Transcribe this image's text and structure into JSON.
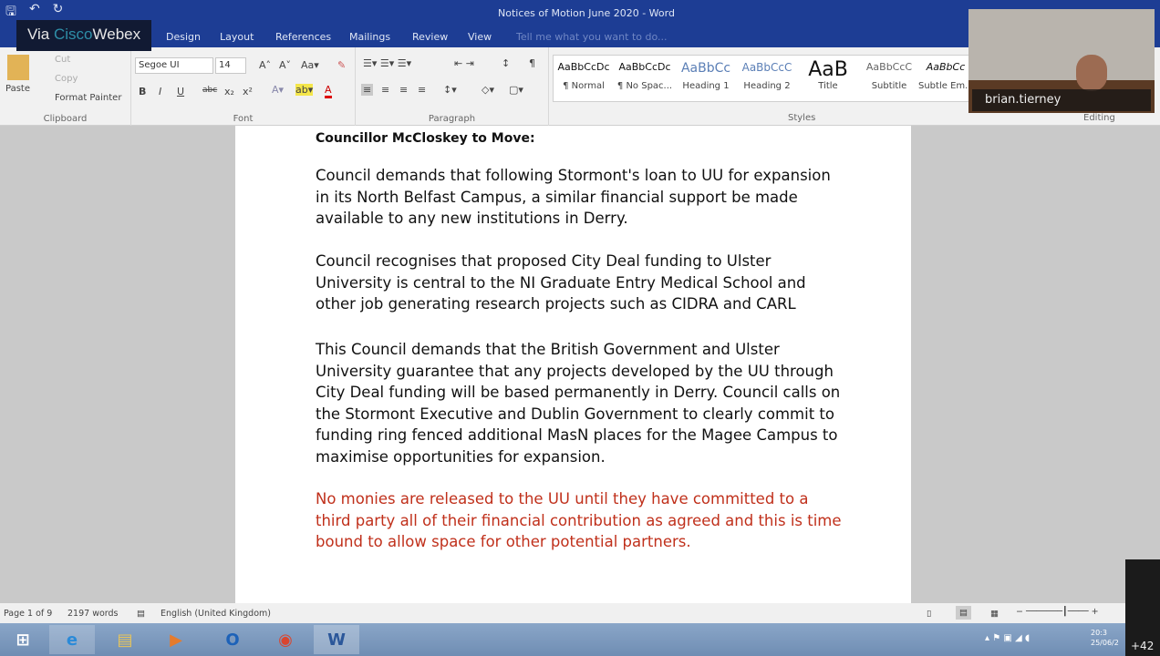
{
  "window": {
    "title": "Notices of Motion June 2020 - Word"
  },
  "webex": {
    "via": "Via ",
    "cisco": "Cisco",
    "webex": "Webex",
    "participant": "brian.tierney"
  },
  "tabs": [
    "Design",
    "Layout",
    "References",
    "Mailings",
    "Review",
    "View"
  ],
  "tell_me": "Tell me what you want to do...",
  "clipboard": {
    "paste": "Paste",
    "cut": "Cut",
    "copy": "Copy",
    "format_painter": "Format Painter",
    "label": "Clipboard"
  },
  "font": {
    "name": "Segoe UI",
    "size": "14",
    "label": "Font",
    "bold": "B",
    "italic": "I",
    "underline": "U",
    "strike": "abc",
    "sub": "x₂",
    "sup": "x²"
  },
  "paragraph": {
    "label": "Paragraph"
  },
  "styles": {
    "label": "Styles",
    "items": [
      {
        "sample": "AaBbCcDc",
        "name": "¶ Normal"
      },
      {
        "sample": "AaBbCcDc",
        "name": "¶ No Spac..."
      },
      {
        "sample": "AaBbCc",
        "name": "Heading 1"
      },
      {
        "sample": "AaBbCcC",
        "name": "Heading 2"
      },
      {
        "sample": "AaB",
        "name": "Title"
      },
      {
        "sample": "AaBbCcC",
        "name": "Subtitle"
      },
      {
        "sample": "AaBbCc",
        "name": "Subtle Em..."
      }
    ]
  },
  "editing": {
    "label": "Editing"
  },
  "document": {
    "heading": "Councillor McCloskey to Move:",
    "p1": "Council demands that following Stormont's loan to UU for expansion in its North Belfast Campus, a similar financial support be made available to any new institutions in Derry.",
    "p2": "Council recognises that proposed City Deal funding to Ulster University is central to the NI Graduate Entry Medical School and other job generating research projects such as CIDRA and CARL",
    "p3": "This Council demands that the British Government and Ulster University guarantee that any projects developed by the UU through City Deal funding will be based permanently in Derry.  Council calls on the Stormont Executive and Dublin Government to clearly commit to funding ring fenced additional MasN places for the Magee Campus to maximise opportunities for expansion.",
    "p4": "No monies are released to the UU until they have committed to a third party all of their financial contribution as agreed and this is time bound to allow space for other potential partners."
  },
  "status": {
    "page": "Page 1 of 9",
    "words": "2197 words",
    "language": "English (United Kingdom)"
  },
  "taskbar": {
    "time": "20:3",
    "date": "25/06/2",
    "extra": "+42"
  }
}
